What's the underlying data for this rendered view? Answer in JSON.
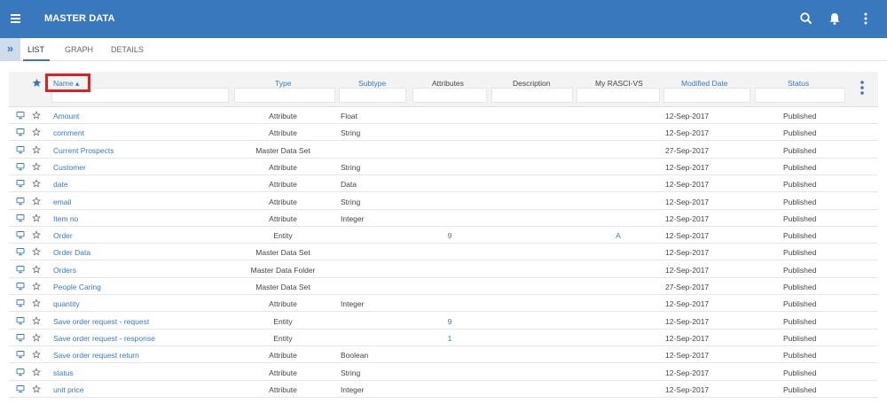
{
  "app": {
    "title": "MASTER DATA",
    "icons": [
      "hamburger-menu-icon",
      "search-icon",
      "bell-icon",
      "more-vertical-icon"
    ]
  },
  "tabs": [
    {
      "label": "LIST",
      "active": true
    },
    {
      "label": "GRAPH",
      "active": false
    },
    {
      "label": "DETAILS",
      "active": false
    }
  ],
  "grid": {
    "columns": {
      "name": "Name ▴",
      "type": "Type",
      "subtype": "Subtype",
      "attributes": "Attributes",
      "description": "Description",
      "rasci": "My RASCI-VS",
      "modified": "Modified Date",
      "status": "Status"
    },
    "rows": [
      {
        "name": "Amount",
        "type": "Attribute",
        "subtype": "Float",
        "attributes": "",
        "rasci": "",
        "modified": "12-Sep-2017",
        "status": "Published"
      },
      {
        "name": "comment",
        "type": "Attribute",
        "subtype": "String",
        "attributes": "",
        "rasci": "",
        "modified": "12-Sep-2017",
        "status": "Published"
      },
      {
        "name": "Current Prospects",
        "type": "Master Data Set",
        "subtype": "",
        "attributes": "",
        "rasci": "",
        "modified": "27-Sep-2017",
        "status": "Published"
      },
      {
        "name": "Customer",
        "type": "Attribute",
        "subtype": "String",
        "attributes": "",
        "rasci": "",
        "modified": "12-Sep-2017",
        "status": "Published"
      },
      {
        "name": "date",
        "type": "Attribute",
        "subtype": "Data",
        "attributes": "",
        "rasci": "",
        "modified": "12-Sep-2017",
        "status": "Published"
      },
      {
        "name": "email",
        "type": "Attribute",
        "subtype": "String",
        "attributes": "",
        "rasci": "",
        "modified": "12-Sep-2017",
        "status": "Published"
      },
      {
        "name": "Item no",
        "type": "Attribute",
        "subtype": "Integer",
        "attributes": "",
        "rasci": "",
        "modified": "12-Sep-2017",
        "status": "Published"
      },
      {
        "name": "Order",
        "type": "Entity",
        "subtype": "",
        "attributes": "9",
        "rasci": "A",
        "modified": "12-Sep-2017",
        "status": "Published"
      },
      {
        "name": "Order Data",
        "type": "Master Data Set",
        "subtype": "",
        "attributes": "",
        "rasci": "",
        "modified": "12-Sep-2017",
        "status": "Published"
      },
      {
        "name": "Orders",
        "type": "Master Data Folder",
        "subtype": "",
        "attributes": "",
        "rasci": "",
        "modified": "12-Sep-2017",
        "status": "Published"
      },
      {
        "name": "People Caring",
        "type": "Master Data Set",
        "subtype": "",
        "attributes": "",
        "rasci": "",
        "modified": "27-Sep-2017",
        "status": "Published"
      },
      {
        "name": "quantity",
        "type": "Attribute",
        "subtype": "Integer",
        "attributes": "",
        "rasci": "",
        "modified": "12-Sep-2017",
        "status": "Published"
      },
      {
        "name": "Save order request - request",
        "type": "Entity",
        "subtype": "",
        "attributes": "9",
        "rasci": "",
        "modified": "12-Sep-2017",
        "status": "Published"
      },
      {
        "name": "Save order request - response",
        "type": "Entity",
        "subtype": "",
        "attributes": "1",
        "rasci": "",
        "modified": "12-Sep-2017",
        "status": "Published"
      },
      {
        "name": "Save order request return",
        "type": "Attribute",
        "subtype": "Boolean",
        "attributes": "",
        "rasci": "",
        "modified": "12-Sep-2017",
        "status": "Published"
      },
      {
        "name": "status",
        "type": "Attribute",
        "subtype": "String",
        "attributes": "",
        "rasci": "",
        "modified": "12-Sep-2017",
        "status": "Published"
      },
      {
        "name": "unit price",
        "type": "Attribute",
        "subtype": "Integer",
        "attributes": "",
        "rasci": "",
        "modified": "12-Sep-2017",
        "status": "Published"
      }
    ]
  },
  "colors": {
    "primary": "#3a78bd",
    "highlight": "#e02020",
    "header_bg": "#f3f3f3"
  }
}
